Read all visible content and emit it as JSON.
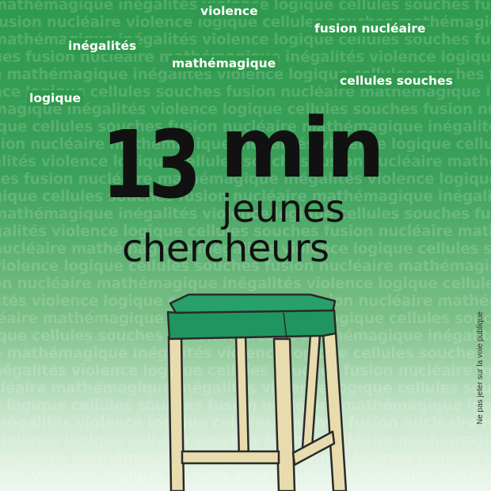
{
  "poster": {
    "background_top_color": "#2f9a4d",
    "background_bottom_color": "#eef7ef",
    "text_color": "#111111"
  },
  "background_words": [
    "mathémagique inégalités violence logique cellules souches fusion nucléaire mathémagique",
    "fusion nucléaire violence logique cellules souches mathémagique inégalités violence",
    "mathémagique inégalités violence logique cellules souches fusion nucléaire inégalités",
    "ues fusion nucléaire mathémagique inégalités violence logique cellules souches fusion",
    "e mathémagique inégalités violence logique cellules souches fusion nucléaire logique",
    "nce logique cellules souches fusion nucléaire mathémagique inégalités violence logique",
    "magique inégalités violence logique cellules souches fusion nucléaire mathémagique",
    "ique cellules souches fusion nucléaire mathémagique inégalités violence logique cellules",
    "sion nucléaire mathémagique inégalités violence logique cellules souches fusion nucléaire",
    "alités violence logique cellules souches fusion nucléaire mathémagique inégalités",
    "ces fusion nucléaire mathémagique inégalités violence logique cellules souches fusion",
    "gique cellules souches fusion nucléaire mathémagique inégalités violence logique cellules",
    "mathémagique inégalités violence logique cellules souches fusion nucléaire mathémagique",
    "galités violence logique cellules souches fusion nucléaire mathémagique inégalités violence",
    "nucléaire mathémagique inégalités violence logique cellules souches fusion nucléaire",
    "violence logique cellules souches fusion nucléaire mathémagique inégalités violence logique",
    "on nucléaire mathémagique inégalités violence logique cellules souches fusion nucléaire",
    "lités violence logique cellules souches fusion nucléaire mathémagique inégalités violence",
    "léaire mathémagique inégalités violence logique cellules souches fusion nucléaire",
    "ique cellules souches fusion nucléaire mathémagique inégalités violence logique cellules",
    "e mathémagique inégalités violence logique cellules souches fusion nucléaire mathémagique",
    "négalités violence logique cellules souches fusion nucléaire mathémagique inégalités",
    "cléaire mathémagique inégalités violence logique cellules souches fusion nucléaire",
    "e logique cellules souches fusion nucléaire mathémagique inégalités violence logique",
    "inégalités violence logique cellules souches fusion nucléaire mathémagique inégalités",
    "violence logique cellules souches fusion nucléaire mathémagique inégalités violence",
    "nucléaire mathémagique inégalités violence logique cellules souches fusion nucléaire",
    "lités violence logique cellules souches fusion nucléaire mathémagique inégalités violence"
  ],
  "highlighted_words": {
    "violence": "violence",
    "fusion_nucleaire": "fusion nucléaire",
    "inegalites": "inégalités",
    "mathemagique": "mathémagique",
    "cellules_souches": "cellules souches",
    "logique": "logique"
  },
  "title": {
    "number": "13",
    "unit": "min",
    "subtitle_line1": "jeunes",
    "subtitle_line2": "chercheurs"
  },
  "side_note": "Ne pas jeter sur la voie publique",
  "stool": {
    "seat_color": "#27a06a",
    "leg_color": "#e8dcae",
    "outline_color": "#2a2a2a"
  }
}
